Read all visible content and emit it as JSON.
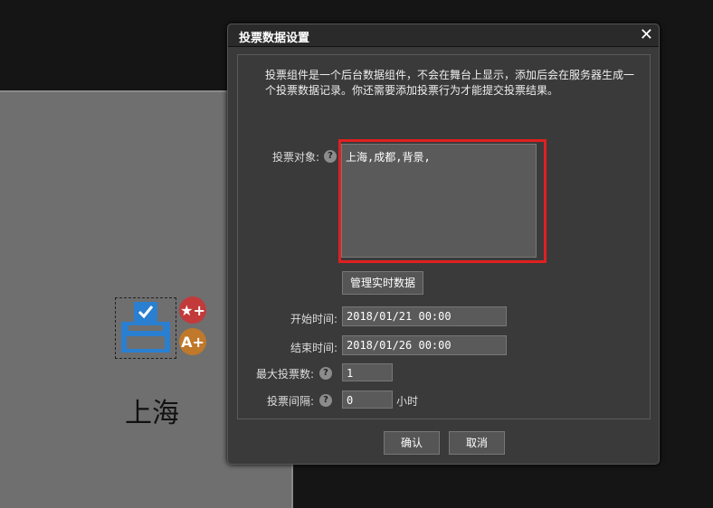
{
  "canvas": {
    "label": "上海",
    "fav_symbol": "★+",
    "text_symbol": "A+"
  },
  "dialog": {
    "title": "投票数据设置",
    "close_symbol": "✕",
    "description": "投票组件是一个后台数据组件，不会在舞台上显示，添加后会在服务器生成一个投票数据记录。你还需要添加投票行为才能提交投票结果。",
    "vote_target": {
      "label": "投票对象:",
      "value": "上海,成都,背景,"
    },
    "manage_button": "管理实时数据",
    "start_time": {
      "label": "开始时间:",
      "value": "2018/01/21 00:00"
    },
    "end_time": {
      "label": "结束时间:",
      "value": "2018/01/26 00:00"
    },
    "max_votes": {
      "label": "最大投票数:",
      "value": "1"
    },
    "interval": {
      "label": "投票间隔:",
      "value": "0",
      "unit": "小时"
    },
    "help_symbol": "?",
    "confirm_label": "确认",
    "cancel_label": "取消"
  },
  "colors": {
    "highlight": "#e02020",
    "accent_blue": "#2a7fd0"
  }
}
